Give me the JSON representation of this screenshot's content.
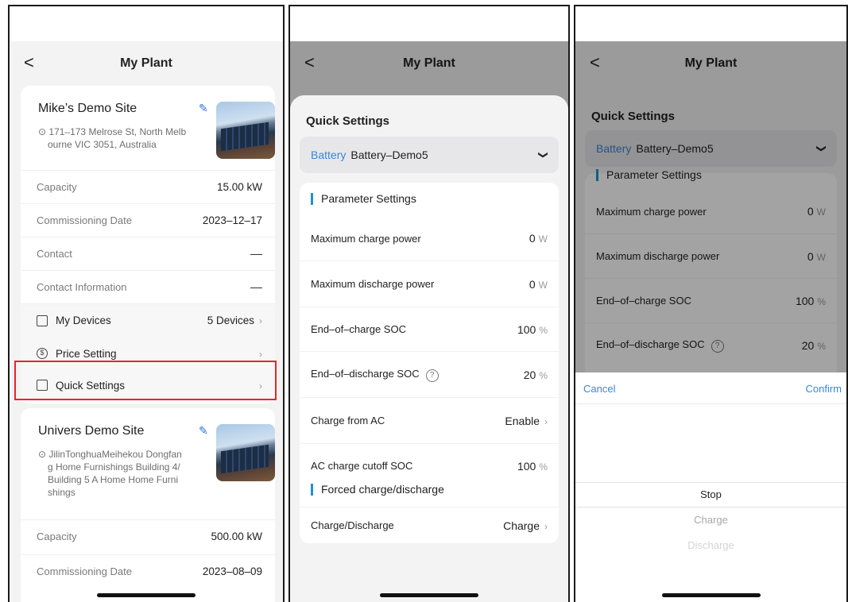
{
  "nav": {
    "back": "<",
    "title": "My Plant"
  },
  "panel1": {
    "site1": {
      "name": "Mike’s Demo Site",
      "address": [
        "171–173 Melrose St, North Melb",
        "ourne VIC 3051, Australia"
      ],
      "rows": [
        {
          "label": "Capacity",
          "value": "15.00 kW"
        },
        {
          "label": "Commissioning Date",
          "value": "2023–12–17"
        },
        {
          "label": "Contact",
          "value": "––"
        },
        {
          "label": "Contact Information",
          "value": "––"
        }
      ],
      "menu": [
        {
          "label": "My Devices",
          "value": "5 Devices",
          "icon": "devices-icon"
        },
        {
          "label": "Price Setting",
          "value": "",
          "icon": "dollar-icon"
        },
        {
          "label": "Quick Settings",
          "value": "",
          "icon": "quick-settings-icon"
        }
      ]
    },
    "site2": {
      "name": "Univers Demo Site",
      "address": [
        "JilinTonghuaMeihekou Dongfan",
        "g Home Furnishings Building 4/",
        "Building 5 A Home Home Furni",
        "shings"
      ],
      "rows": [
        {
          "label": "Capacity",
          "value": "500.00 kW"
        },
        {
          "label": "Commissioning Date",
          "value": "2023–08–09"
        }
      ]
    }
  },
  "sheet": {
    "title": "Quick Settings",
    "battery_label": "Battery",
    "battery_value": "Battery–Demo5",
    "section1": "Parameter Settings",
    "params": [
      {
        "label": "Maximum charge power",
        "value": "0",
        "unit": "W"
      },
      {
        "label": "Maximum discharge power",
        "value": "0",
        "unit": "W"
      },
      {
        "label": "End–of–charge SOC",
        "value": "100",
        "unit": "%"
      },
      {
        "label": "End–of–discharge SOC",
        "value": "20",
        "unit": "%"
      },
      {
        "label": "Charge from AC",
        "value": "Enable",
        "unit": ""
      },
      {
        "label": "AC charge cutoff SOC",
        "value": "100",
        "unit": "%"
      }
    ],
    "section2": "Forced charge/discharge",
    "forced": {
      "label": "Charge/Discharge",
      "value": "Charge"
    }
  },
  "picker": {
    "cancel": "Cancel",
    "confirm": "Confirm",
    "options": [
      "Stop",
      "Charge",
      "Discharge"
    ],
    "selected": "Stop"
  },
  "colors": {
    "accent": "#3a86d6",
    "highlight": "#e3262b",
    "section_bar": "#1e90d6"
  }
}
